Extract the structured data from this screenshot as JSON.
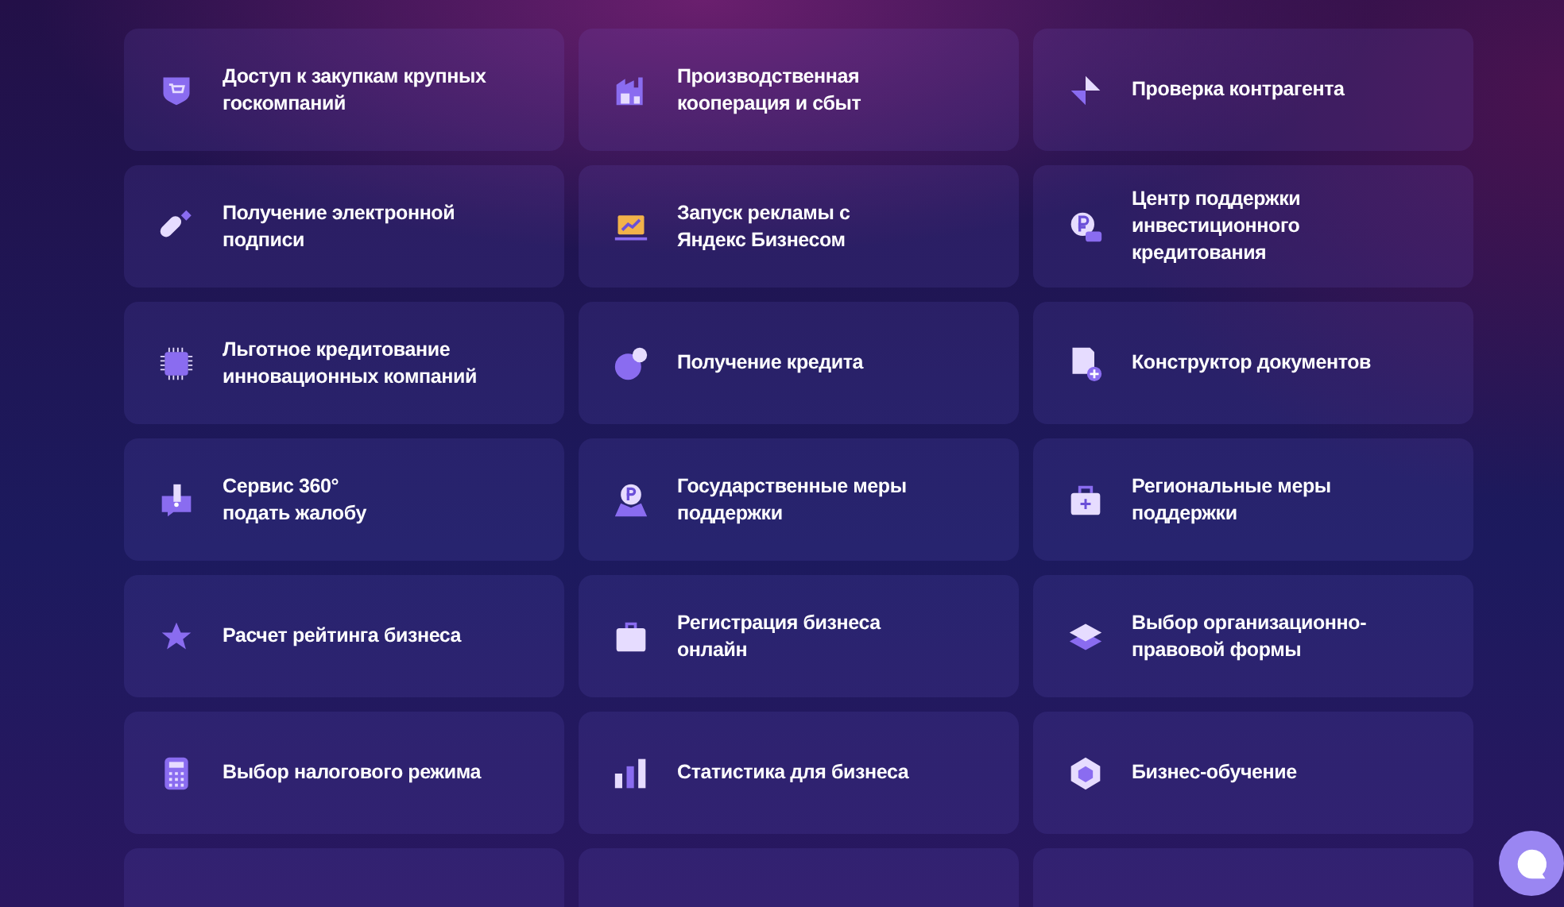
{
  "services": [
    {
      "kind": "service",
      "title": "Доступ к закупкам крупных\nгоскомпаний"
    },
    {
      "kind": "service",
      "title": "Производственная\nкооперация и сбыт"
    },
    {
      "kind": "service",
      "title": "Проверка контрагента"
    },
    {
      "kind": "service",
      "title": "Получение электронной\nподписи"
    },
    {
      "kind": "service",
      "title": "Запуск рекламы с\nЯндекс Бизнесом"
    },
    {
      "kind": "service",
      "title": "Центр поддержки\nинвестиционного\nкредитования"
    },
    {
      "kind": "service",
      "title": "Льготное кредитование\nинновационных компаний"
    },
    {
      "kind": "service",
      "title": "Получение кредита"
    },
    {
      "kind": "service",
      "title": "Конструктор документов"
    },
    {
      "kind": "service",
      "title": "Сервис 360°\nподать жалобу"
    },
    {
      "kind": "service",
      "title": "Государственные меры\nподдержки"
    },
    {
      "kind": "service",
      "title": "Региональные меры\nподдержки"
    },
    {
      "kind": "service",
      "title": "Расчет рейтинга бизнеса"
    },
    {
      "kind": "service",
      "title": "Регистрация бизнеса\nонлайн"
    },
    {
      "kind": "service",
      "title": "Выбор организационно-\nправовой формы"
    },
    {
      "kind": "service",
      "title": "Выбор налогового режима"
    },
    {
      "kind": "service",
      "title": "Статистика для бизнеса"
    },
    {
      "kind": "service",
      "title": "Бизнес-обучение"
    },
    {
      "kind": "cut"
    },
    {
      "kind": "cut"
    },
    {
      "kind": "cut"
    }
  ],
  "chat_button": {
    "kind": "chat"
  }
}
